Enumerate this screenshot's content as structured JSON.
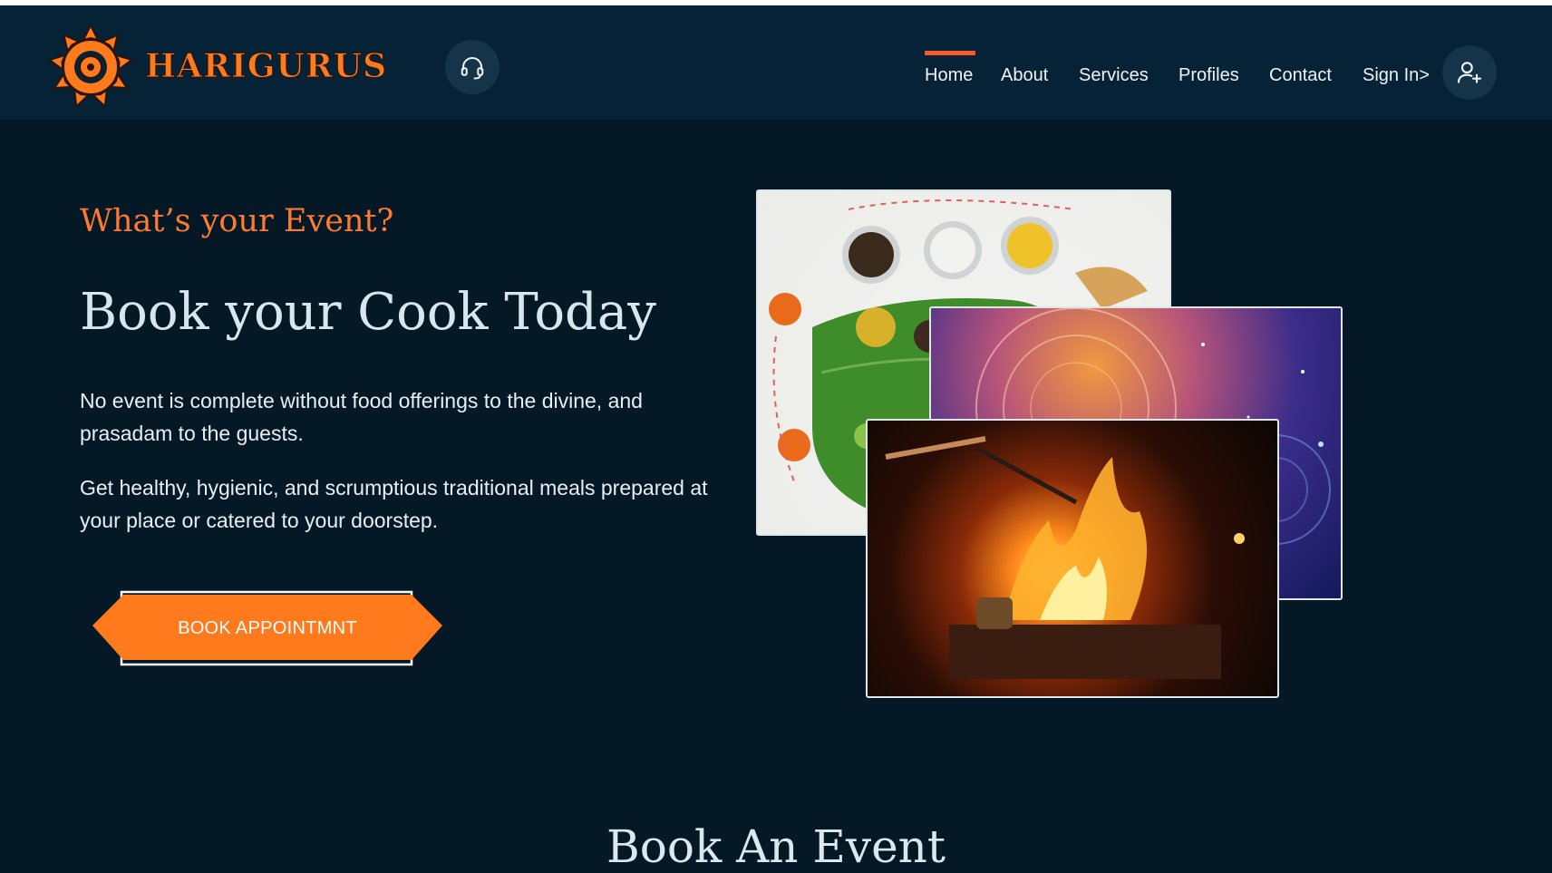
{
  "brand": {
    "name": "HARIGURUS",
    "accent": "#ff7a1c"
  },
  "header": {
    "support_icon": "headset-icon",
    "nav": [
      {
        "label": "Home",
        "active": true
      },
      {
        "label": "About",
        "active": false
      },
      {
        "label": "Services",
        "active": false
      },
      {
        "label": "Profiles",
        "active": false
      },
      {
        "label": "Contact",
        "active": false
      },
      {
        "label": "Sign In>",
        "active": false
      }
    ],
    "user_icon": "add-user-icon"
  },
  "hero": {
    "eyebrow": "What’s your Event?",
    "title": "Book your Cook Today",
    "paragraph1": "No event is complete without food offerings to the divine, and prasadam to the guests.",
    "paragraph2": "Get healthy, hygienic, and scrumptious traditional meals prepared at your place or catered to your doorstep.",
    "cta_label": "BOOK APPOINTMNT",
    "images": [
      "food-thali-image",
      "astrology-zodiac-image",
      "fire-ritual-image"
    ]
  },
  "section": {
    "title": "Book An Event"
  },
  "colors": {
    "background": "#041826",
    "navbar": "#062236",
    "cta": "#ff7a1c",
    "active_indicator": "#ff5a2a"
  }
}
